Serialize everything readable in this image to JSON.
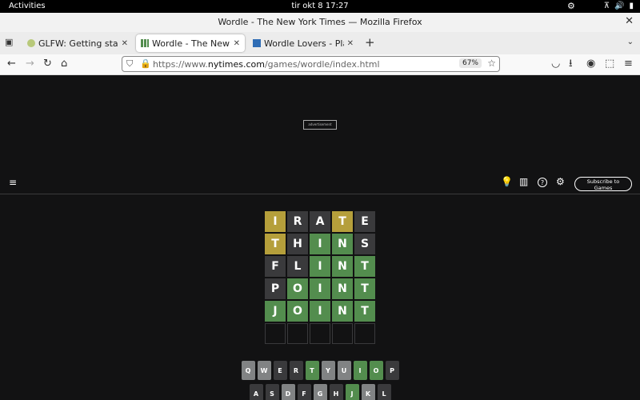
{
  "system": {
    "activities": "Activities",
    "clock": "tir okt 8  17:27"
  },
  "window": {
    "title": "Wordle - The New York Times — Mozilla Firefox"
  },
  "tabs": [
    {
      "label": "GLFW: Getting started",
      "active": false
    },
    {
      "label": "Wordle - The New York",
      "active": true
    },
    {
      "label": "Wordle Lovers - Play th",
      "active": false
    }
  ],
  "urlbar": {
    "prefix": "https://www.",
    "domain": "nytimes.com",
    "path": "/games/wordle/index.html",
    "zoom": "67%"
  },
  "page": {
    "ad_label": "advertisement",
    "subscribe_line1": "Subscribe to",
    "subscribe_line2": "Games"
  },
  "board": [
    [
      {
        "l": "I",
        "s": "present"
      },
      {
        "l": "R",
        "s": "absent"
      },
      {
        "l": "A",
        "s": "absent"
      },
      {
        "l": "T",
        "s": "present"
      },
      {
        "l": "E",
        "s": "absent"
      }
    ],
    [
      {
        "l": "T",
        "s": "present"
      },
      {
        "l": "H",
        "s": "absent"
      },
      {
        "l": "I",
        "s": "correct"
      },
      {
        "l": "N",
        "s": "correct"
      },
      {
        "l": "S",
        "s": "absent"
      }
    ],
    [
      {
        "l": "F",
        "s": "absent"
      },
      {
        "l": "L",
        "s": "absent"
      },
      {
        "l": "I",
        "s": "correct"
      },
      {
        "l": "N",
        "s": "correct"
      },
      {
        "l": "T",
        "s": "correct"
      }
    ],
    [
      {
        "l": "P",
        "s": "absent"
      },
      {
        "l": "O",
        "s": "correct"
      },
      {
        "l": "I",
        "s": "correct"
      },
      {
        "l": "N",
        "s": "correct"
      },
      {
        "l": "T",
        "s": "correct"
      }
    ],
    [
      {
        "l": "J",
        "s": "correct"
      },
      {
        "l": "O",
        "s": "correct"
      },
      {
        "l": "I",
        "s": "correct"
      },
      {
        "l": "N",
        "s": "correct"
      },
      {
        "l": "T",
        "s": "correct"
      }
    ],
    [
      {
        "l": "",
        "s": "empty"
      },
      {
        "l": "",
        "s": "empty"
      },
      {
        "l": "",
        "s": "empty"
      },
      {
        "l": "",
        "s": "empty"
      },
      {
        "l": "",
        "s": "empty"
      }
    ]
  ],
  "keyboard": [
    [
      {
        "k": "Q",
        "s": "unused"
      },
      {
        "k": "W",
        "s": "unused"
      },
      {
        "k": "E",
        "s": "absent"
      },
      {
        "k": "R",
        "s": "absent"
      },
      {
        "k": "T",
        "s": "correct"
      },
      {
        "k": "Y",
        "s": "unused"
      },
      {
        "k": "U",
        "s": "unused"
      },
      {
        "k": "I",
        "s": "correct"
      },
      {
        "k": "O",
        "s": "correct"
      },
      {
        "k": "P",
        "s": "absent"
      }
    ],
    [
      {
        "k": "A",
        "s": "absent"
      },
      {
        "k": "S",
        "s": "absent"
      },
      {
        "k": "D",
        "s": "unused"
      },
      {
        "k": "F",
        "s": "absent"
      },
      {
        "k": "G",
        "s": "unused"
      },
      {
        "k": "H",
        "s": "absent"
      },
      {
        "k": "J",
        "s": "correct"
      },
      {
        "k": "K",
        "s": "unused"
      },
      {
        "k": "L",
        "s": "absent"
      }
    ]
  ],
  "colors": {
    "correct": "#538d4e",
    "present": "#b59f3b",
    "absent": "#3a3a3c",
    "unused": "#818384",
    "background": "#121213"
  },
  "icons": {
    "back": "←",
    "forward": "→",
    "reload": "↻",
    "home": "⌂",
    "shield": "⛉",
    "lock": "🔒",
    "star": "☆",
    "pocket": "◡",
    "download": "⭳",
    "account": "◉",
    "extensions": "⬚",
    "menu": "≡",
    "hamburger": "≡",
    "hint": "💡",
    "stats": "▥",
    "help": "?",
    "settings": "⚙"
  }
}
